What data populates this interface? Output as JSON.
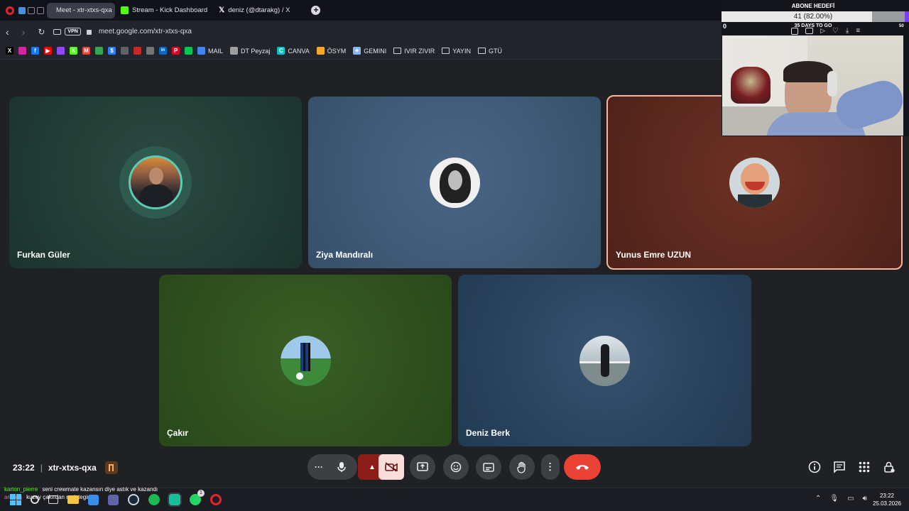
{
  "tabs": [
    {
      "label": "Meet - xtr-xtxs-qxa",
      "active": true,
      "color": "#00897b"
    },
    {
      "label": "Stream - Kick Dashboard",
      "active": false,
      "color": "#53fc18"
    },
    {
      "label": "deniz (@dtarakg) / X",
      "active": false,
      "color": "#ffffff"
    }
  ],
  "address": {
    "url": "meet.google.com/xtr-xtxs-qxa",
    "vpn_label": "VPN"
  },
  "bookmarks": [
    {
      "label": "",
      "icon": "x-icon",
      "color": "#000000",
      "glyph": "X"
    },
    {
      "label": "",
      "icon": "instagram-icon",
      "color": "#d6249f",
      "glyph": ""
    },
    {
      "label": "",
      "icon": "facebook-icon",
      "color": "#1877f2",
      "glyph": "f"
    },
    {
      "label": "",
      "icon": "youtube-icon",
      "color": "#ff0000",
      "glyph": "▶"
    },
    {
      "label": "",
      "icon": "twitch-icon",
      "color": "#9146ff",
      "glyph": ""
    },
    {
      "label": "",
      "icon": "kick-icon",
      "color": "#53fc18",
      "glyph": "K"
    },
    {
      "label": "",
      "icon": "gmail-icon",
      "color": "#ea4335",
      "glyph": "M"
    },
    {
      "label": "",
      "icon": "maps-icon",
      "color": "#34a853",
      "glyph": ""
    },
    {
      "label": "",
      "icon": "dollar-icon",
      "color": "#2d7ff9",
      "glyph": "$"
    },
    {
      "label": "",
      "icon": "link-icon",
      "color": "#5f6368",
      "glyph": ""
    },
    {
      "label": "",
      "icon": "red-icon",
      "color": "#c62828",
      "glyph": ""
    },
    {
      "label": "",
      "icon": "gray-icon",
      "color": "#757575",
      "glyph": ""
    },
    {
      "label": "",
      "icon": "linkedin-icon",
      "color": "#0a66c2",
      "glyph": "in"
    },
    {
      "label": "",
      "icon": "pinterest-icon",
      "color": "#e60023",
      "glyph": "P"
    },
    {
      "label": "",
      "icon": "phone-icon",
      "color": "#00c853",
      "glyph": ""
    },
    {
      "label": "MAIL",
      "icon": "mail-icon",
      "color": "#4285f4",
      "glyph": ""
    },
    {
      "label": "DT Peyzaj",
      "icon": "doc-icon",
      "color": "#9e9e9e",
      "glyph": ""
    },
    {
      "label": "CANVA",
      "icon": "canva-icon",
      "color": "#00c4cc",
      "glyph": "C"
    },
    {
      "label": "ÖSYM",
      "icon": "osym-icon",
      "color": "#f9a825",
      "glyph": ""
    },
    {
      "label": "GEMINI",
      "icon": "gemini-icon",
      "color": "#8ab4f8",
      "glyph": "✦"
    },
    {
      "label": "IVIR ZIVIR",
      "icon": "folder-icon",
      "color": "transparent",
      "glyph": ""
    },
    {
      "label": "YAYIN",
      "icon": "folder-icon",
      "color": "transparent",
      "glyph": ""
    },
    {
      "label": "GTÜ",
      "icon": "folder-icon",
      "color": "transparent",
      "glyph": ""
    }
  ],
  "participants": [
    {
      "name": "Furkan Güler",
      "bg": "#1f3b33",
      "speaking": true
    },
    {
      "name": "Ziya Mandıralı",
      "bg": "#3a5470",
      "speaking": false
    },
    {
      "name": "Yunus Emre UZUN",
      "bg": "#5a261c",
      "speaking": false,
      "highlighted": true
    },
    {
      "name": "Çakır",
      "bg": "#2e4e1c",
      "speaking": false
    },
    {
      "name": "Deniz Berk",
      "bg": "#2a4259",
      "speaking": false
    }
  ],
  "meeting": {
    "time": "23:22",
    "code": "xtr-xtxs-qxa"
  },
  "controls": {
    "more": "···"
  },
  "stream_overlay": {
    "title": "ABONE HEDEFİ",
    "progress_text": "41 (82.00%)",
    "progress": 0.82,
    "min": "0",
    "max": "50",
    "days": "35 DAYS TO GO"
  },
  "chat": {
    "user1": "karton_pierre",
    "msg1": "seni crewmate kazansın diye astık ve kazandı",
    "user2": "arnagg",
    "msg2": "kuzey çakırdan ne istegin"
  },
  "taskbar": {
    "time": "23:22",
    "date": "25.03.2026",
    "whatsapp_badge": "1"
  },
  "colors": {
    "hangup": "#ea4335",
    "cam_off": "#f9dedc",
    "speaking_ring": "#5ec9b4",
    "highlight": "#f4b7a4"
  }
}
